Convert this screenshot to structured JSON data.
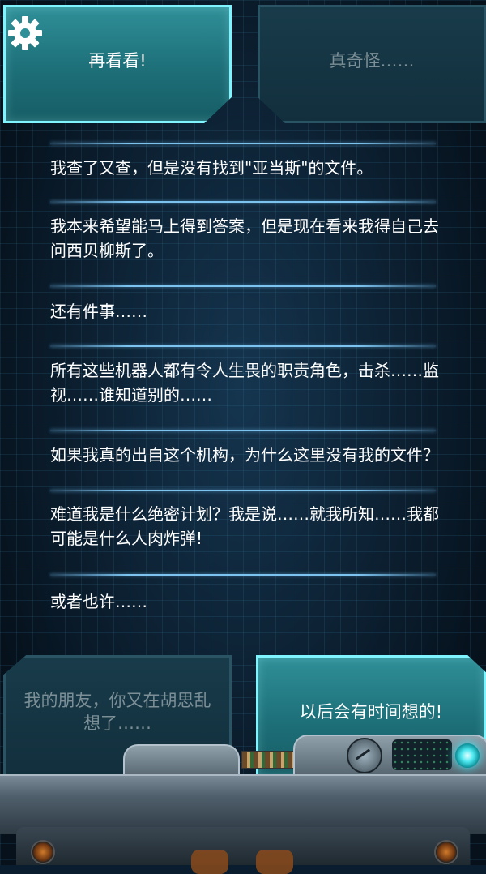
{
  "choices": {
    "top_left": {
      "label": "再看看!",
      "state": "active"
    },
    "top_right": {
      "label": "真奇怪……",
      "state": "inactive"
    },
    "bottom_left": {
      "label": "我的朋友，你又在胡思乱想了……",
      "state": "inactive"
    },
    "bottom_right": {
      "label": "以后会有时间想的!",
      "state": "active"
    }
  },
  "settings": {
    "icon": "gear-icon"
  },
  "messages": [
    "我查了又查，但是没有找到\"亚当斯\"的文件。",
    "我本来希望能马上得到答案，但是现在看来我得自己去问西贝柳斯了。",
    "还有件事……",
    "所有这些机器人都有令人生畏的职责角色，击杀……监视……谁知道别的……",
    "如果我真的出自这个机构，为什么这里没有我的文件？",
    "难道我是什么绝密计划？我是说……就我所知……我都可能是什么人肉炸弹!",
    "或者也许……"
  ],
  "colors": {
    "active_fill": "#1d6f78",
    "active_border": "#7ff4ff",
    "inactive_text": "#7c8f96",
    "divider": "#7cc3f0",
    "status_light": "#39f0ff"
  }
}
